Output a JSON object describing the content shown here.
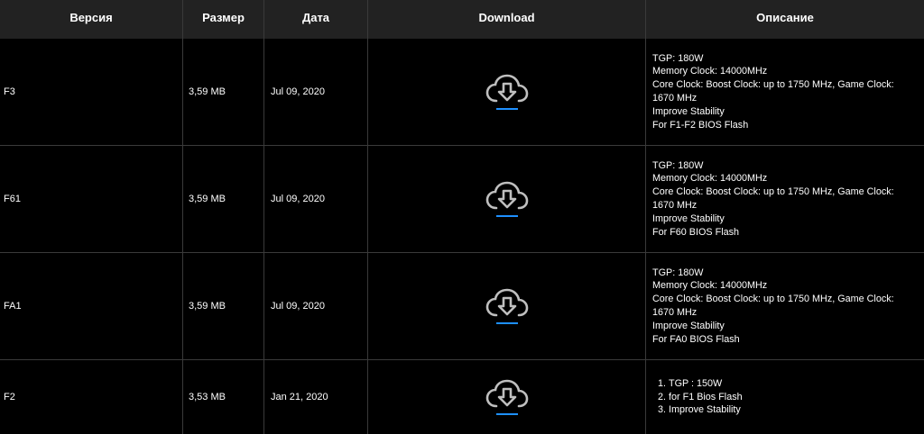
{
  "headers": {
    "version": "Версия",
    "size": "Размер",
    "date": "Дата",
    "download": "Download",
    "description": "Описание"
  },
  "rows": [
    {
      "version": "F3",
      "size": "3,59 MB",
      "date": "Jul 09, 2020",
      "desc": [
        "TGP: 180W",
        "Memory Clock: 14000MHz",
        "Core Clock: Boost Clock: up to 1750 MHz, Game Clock:",
        "1670 MHz",
        "Improve Stability",
        "For F1-F2 BIOS Flash"
      ]
    },
    {
      "version": "F61",
      "size": "3,59 MB",
      "date": "Jul 09, 2020",
      "desc": [
        "TGP: 180W",
        "Memory Clock: 14000MHz",
        "Core Clock: Boost Clock: up to 1750 MHz, Game Clock:",
        "1670 MHz",
        "Improve Stability",
        "For F60 BIOS Flash"
      ]
    },
    {
      "version": "FA1",
      "size": "3,59 MB",
      "date": "Jul 09, 2020",
      "desc": [
        "TGP: 180W",
        "Memory Clock: 14000MHz",
        "Core Clock: Boost Clock: up to 1750 MHz, Game Clock:",
        "1670 MHz",
        "Improve Stability",
        "For FA0 BIOS Flash"
      ]
    },
    {
      "version": "F2",
      "size": "3,53 MB",
      "date": "Jan 21, 2020",
      "desc_list": [
        "TGP : 150W",
        "for F1 Bios Flash",
        "Improve Stability"
      ]
    }
  ],
  "icons": {
    "download": "cloud-download-icon"
  },
  "colors": {
    "header_bg": "#222222",
    "body_bg": "#000000",
    "accent": "#1e90ff",
    "icon": "#bfbfbf"
  }
}
